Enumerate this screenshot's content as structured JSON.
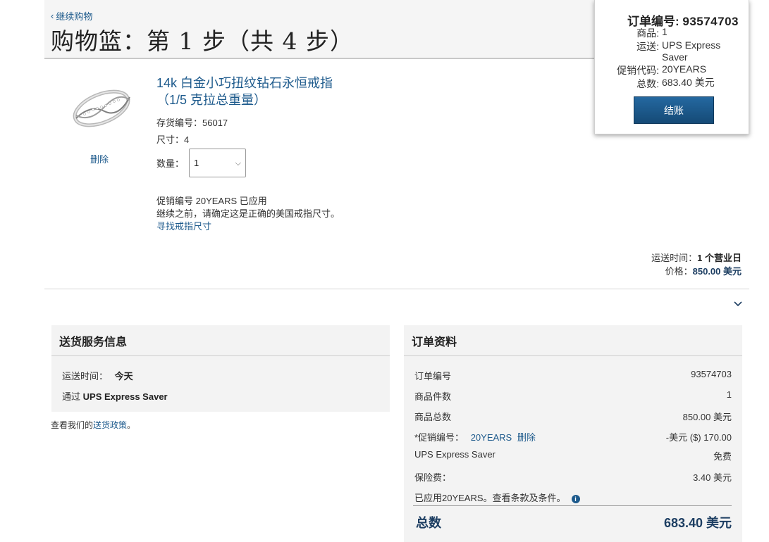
{
  "header": {
    "back_label": "继续购物",
    "title": "购物篮：第 1 步（共 4 步）"
  },
  "summary": {
    "order_label": "订单编号:",
    "order_number": "93574703",
    "rows": [
      {
        "label": "商品:",
        "value": "1"
      },
      {
        "label": "运送:",
        "value": "UPS Express Saver"
      },
      {
        "label": "促销代码:",
        "value": "20YEARS"
      },
      {
        "label": "总数:",
        "value": "683.40 美元"
      }
    ],
    "checkout_label": "结账"
  },
  "item": {
    "title_line1": "14k 白金小巧扭纹钻石永恒戒指",
    "title_line2": "（1/5 克拉总重量）",
    "sku": "存货编号：56017",
    "size": "尺寸：4",
    "qty_label": "数量：",
    "qty_value": "1",
    "remove_label": "删除",
    "promo_applied": "促销编号 20YEARS 已应用",
    "size_notice": "继续之前，请确定这是正确的美国戒指尺寸。",
    "find_size_link": "寻找戒指尺寸",
    "ship_time_label": "运送时间：",
    "ship_time_value": "1 个营业日",
    "price_label": "价格：",
    "price_value": "850.00 美元"
  },
  "shipping_panel": {
    "title": "送货服务信息",
    "time_label": "运送时间：",
    "time_value": "今天",
    "via_label": "通过",
    "via_value": "UPS Express Saver",
    "policy_prefix": "查看我们的",
    "policy_link": "送货政策",
    "policy_suffix": "。"
  },
  "order_panel": {
    "title": "订单资料",
    "rows": [
      {
        "label": "订单编号",
        "value": "93574703"
      },
      {
        "label": "商品件数",
        "value": "1"
      },
      {
        "label": "商品总数",
        "value": "850.00 美元"
      },
      {
        "label": "*促销编号：",
        "code": "20YEARS",
        "remove": "删除",
        "value": "-美元 ($) 170.00"
      },
      {
        "label": "UPS Express Saver",
        "value": "免费"
      },
      {
        "label": "保险费：",
        "value": "3.40 美元"
      }
    ],
    "terms_note": "已应用20YEARS。查看条款及条件。",
    "total_label": "总数",
    "total_value": "683.40 美元"
  },
  "icons": {
    "back": "chevron-left-icon",
    "expand": "chevron-down-icon",
    "info": "info-icon"
  },
  "colors": {
    "link": "#1d5a8c",
    "button": "#1d5a8c",
    "total": "#1d3e62"
  }
}
